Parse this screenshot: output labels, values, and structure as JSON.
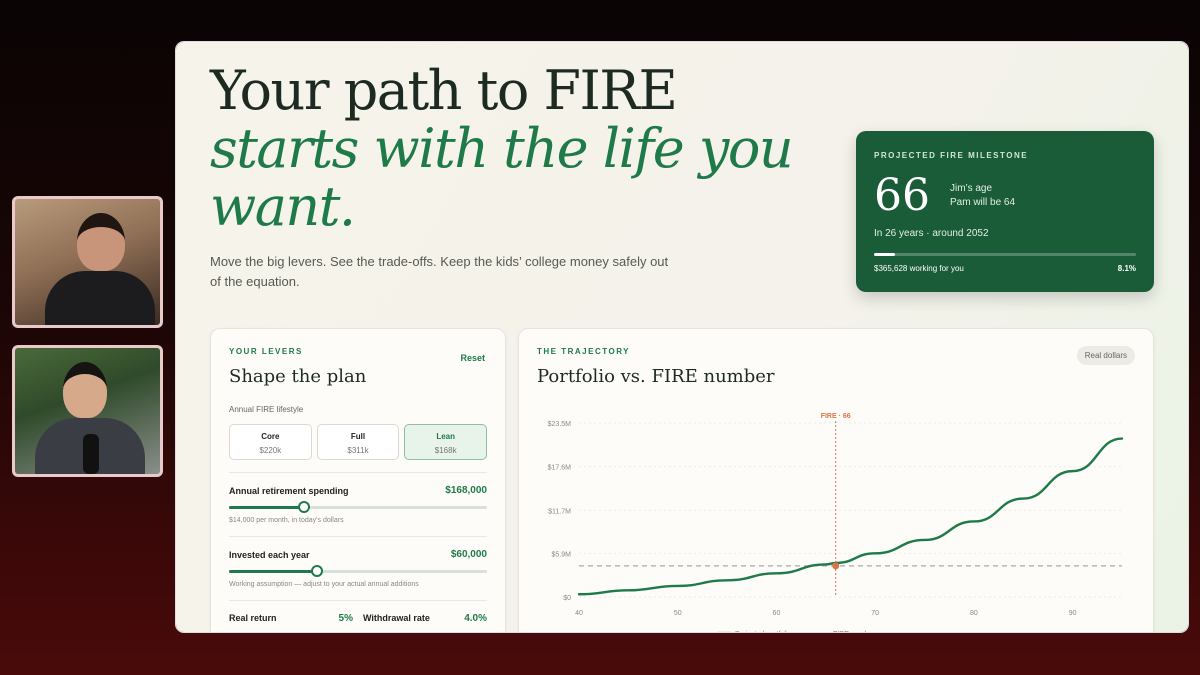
{
  "hero": {
    "title_line1": "Your path to FIRE",
    "title_line2": "starts with the life you",
    "title_line3": "want.",
    "subtitle": "Move the big levers. See the trade-offs. Keep the kids’ college money safely out of the equation."
  },
  "milestone": {
    "label": "PROJECTED FIRE MILESTONE",
    "age": "66",
    "line1": "Jim’s age",
    "line2": "Pam will be 64",
    "years": "In 26 years · around 2052",
    "progress": 0.081,
    "working": "$365,628 working for you",
    "percent": "8.1%"
  },
  "levers": {
    "eyebrow": "YOUR LEVERS",
    "title": "Shape the plan",
    "reset": "Reset",
    "lifestyle_label": "Annual FIRE lifestyle",
    "options": [
      {
        "name": "Core",
        "value": "$220k"
      },
      {
        "name": "Full",
        "value": "$311k"
      },
      {
        "name": "Lean",
        "value": "$168k"
      }
    ],
    "selected_option": "Lean",
    "spending": {
      "label": "Annual retirement spending",
      "value": "$168,000",
      "hint": "$14,000 per month, in today's dollars",
      "level": 0.29
    },
    "invested": {
      "label": "Invested each year",
      "value": "$60,000",
      "hint": "Working assumption — adjust to your actual annual additions",
      "level": 0.34
    },
    "real_return": {
      "label": "Real return",
      "value": "5%"
    },
    "withdrawal": {
      "label": "Withdrawal rate",
      "value": "4.0%"
    }
  },
  "trajectory": {
    "eyebrow": "THE TRAJECTORY",
    "title": "Portfolio vs. FIRE number",
    "pill": "Real dollars"
  },
  "chart_data": {
    "type": "line",
    "x": [
      40,
      45,
      50,
      55,
      60,
      65,
      66,
      70,
      75,
      80,
      85,
      90,
      95
    ],
    "series": [
      {
        "name": "Projected portfolio",
        "values": [
          0.37,
          0.9,
          1.5,
          2.25,
          3.2,
          4.4,
          4.6,
          5.9,
          7.7,
          10.2,
          13.3,
          17.0,
          21.4
        ]
      },
      {
        "name": "FIRE number",
        "values": [
          4.2,
          4.2,
          4.2,
          4.2,
          4.2,
          4.2,
          4.2,
          4.2,
          4.2,
          4.2,
          4.2,
          4.2,
          4.2
        ]
      }
    ],
    "xticks": [
      "40",
      "50",
      "60",
      "70",
      "80",
      "90"
    ],
    "yticks": [
      "$0",
      "$5.9M",
      "$11.7M",
      "$17.6M",
      "$23.5M"
    ],
    "ytick_values": [
      0,
      5.9,
      11.7,
      17.6,
      23.5
    ],
    "xlim": [
      40,
      95
    ],
    "ylim": [
      0,
      23.5
    ],
    "marker": {
      "x": 66,
      "y": 4.2,
      "label": "FIRE · 66"
    },
    "colors": {
      "portfolio": "#1e7a48",
      "fire": "#a8a8a8",
      "marker": "#d9744a"
    }
  }
}
